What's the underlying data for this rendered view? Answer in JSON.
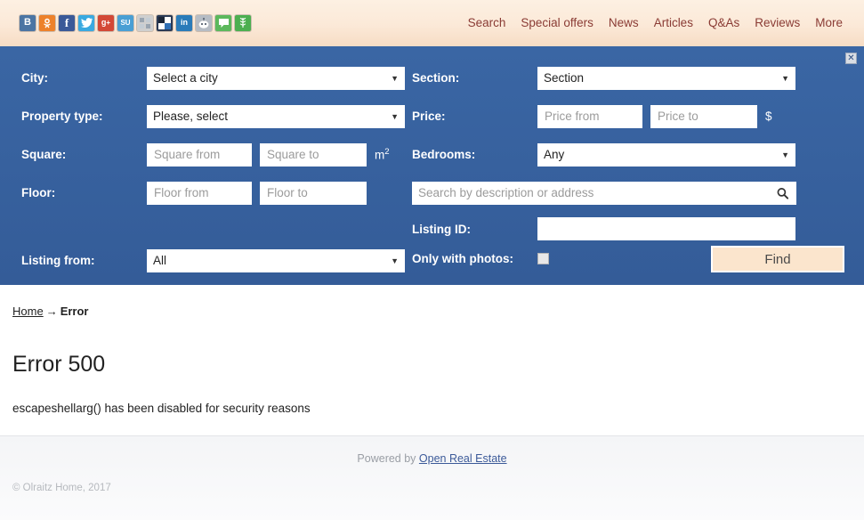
{
  "header": {
    "social_icons": [
      {
        "name": "vkontakte-icon",
        "glyph": "B",
        "bg": "#4c75a3",
        "fg": "#ffffff"
      },
      {
        "name": "odnoklassniki-icon",
        "glyph": "\u0001",
        "bg": "#ed812b",
        "fg": "#ffffff"
      },
      {
        "name": "facebook-icon",
        "glyph": "f",
        "bg": "#3b5998",
        "fg": "#ffffff"
      },
      {
        "name": "twitter-icon",
        "glyph": "\u0002",
        "bg": "#3aa9e0",
        "fg": "#ffffff"
      },
      {
        "name": "google-plus-icon",
        "glyph": "g+",
        "bg": "#d34836",
        "fg": "#ffffff"
      },
      {
        "name": "stumbleupon-icon",
        "glyph": "SU",
        "bg": "#4a9fd4",
        "fg": "#ffffff"
      },
      {
        "name": "delicious-icon",
        "glyph": "\u0003",
        "bg": "#c8c8c8",
        "fg": "#ffffff"
      },
      {
        "name": "blogger-icon",
        "glyph": "\u0004",
        "bg": "#2b3a55",
        "fg": "#ffffff"
      },
      {
        "name": "linkedin-icon",
        "glyph": "in",
        "bg": "#2a7bb9",
        "fg": "#ffffff"
      },
      {
        "name": "mail-ru-icon",
        "glyph": "\u0005",
        "bg": "#b6bcc4",
        "fg": "#ffffff"
      },
      {
        "name": "livejournal-icon",
        "glyph": "\u0006",
        "bg": "#4caf50",
        "fg": "#ffffff"
      },
      {
        "name": "evernote-icon",
        "glyph": "\u0007",
        "bg": "#4caf50",
        "fg": "#ffffff"
      }
    ],
    "nav": [
      {
        "label": "Search",
        "name": "nav-search"
      },
      {
        "label": "Special offers",
        "name": "nav-special-offers"
      },
      {
        "label": "News",
        "name": "nav-news"
      },
      {
        "label": "Articles",
        "name": "nav-articles"
      },
      {
        "label": "Q&As",
        "name": "nav-qas"
      },
      {
        "label": "Reviews",
        "name": "nav-reviews"
      },
      {
        "label": "More",
        "name": "nav-more"
      }
    ],
    "accent_link_color": "#8a3b34",
    "background_color": "#fbe9d8"
  },
  "search_panel": {
    "background_color": "#36619e",
    "close_label": "✕",
    "city": {
      "label": "City:",
      "value": "Select a city"
    },
    "property_type": {
      "label": "Property type:",
      "value": "Please, select"
    },
    "square": {
      "label": "Square:",
      "from_placeholder": "Square from",
      "to_placeholder": "Square to",
      "unit": "m",
      "unit_sup": "2"
    },
    "floor": {
      "label": "Floor:",
      "from_placeholder": "Floor from",
      "to_placeholder": "Floor to"
    },
    "listing_from": {
      "label": "Listing from:",
      "value": "All"
    },
    "section": {
      "label": "Section:",
      "value": "Section"
    },
    "price": {
      "label": "Price:",
      "from_placeholder": "Price from",
      "to_placeholder": "Price to",
      "currency": "$"
    },
    "bedrooms": {
      "label": "Bedrooms:",
      "value": "Any"
    },
    "keyword": {
      "placeholder": "Search by description or address",
      "value": ""
    },
    "listing_id": {
      "label": "Listing ID:",
      "value": ""
    },
    "only_with_photos": {
      "label": "Only with photos:",
      "checked": false
    },
    "find_button": {
      "label": "Find",
      "background_color": "#fbe5cd"
    }
  },
  "content": {
    "breadcrumb": {
      "home": "Home",
      "separator": "→",
      "current": "Error"
    },
    "error_title": "Error 500",
    "error_message": "escapeshellarg() has been disabled for security reasons"
  },
  "footer": {
    "powered_prefix": "Powered by ",
    "powered_link": "Open Real Estate",
    "copyright": "© Olraitz Home, 2017"
  }
}
